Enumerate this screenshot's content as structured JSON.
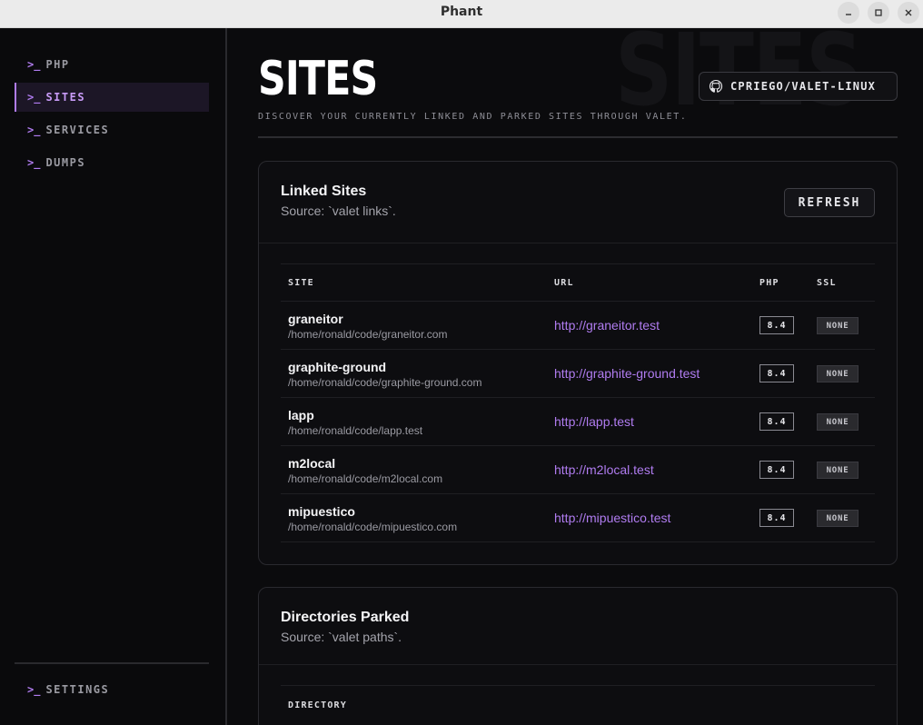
{
  "window": {
    "title": "Phant"
  },
  "sidebar": {
    "prompt": ">_",
    "items": [
      {
        "label": "PHP",
        "active": false
      },
      {
        "label": "SITES",
        "active": true
      },
      {
        "label": "SERVICES",
        "active": false
      },
      {
        "label": "DUMPS",
        "active": false
      }
    ],
    "settings": {
      "label": "SETTINGS"
    }
  },
  "header": {
    "watermark": "SITES",
    "title": "SITES",
    "subtitle": "DISCOVER YOUR CURRENTLY LINKED AND PARKED SITES THROUGH VALET.",
    "repo_label": "CPRIEGO/VALET-LINUX",
    "repo_icon": "github-icon"
  },
  "linked": {
    "title": "Linked Sites",
    "source": "Source: `valet links`.",
    "refresh_label": "REFRESH",
    "columns": [
      "SITE",
      "URL",
      "PHP",
      "SSL"
    ],
    "rows": [
      {
        "name": "graneitor",
        "path": "/home/ronald/code/graneitor.com",
        "url": "http://graneitor.test",
        "php": "8.4",
        "ssl": "NONE"
      },
      {
        "name": "graphite-ground",
        "path": "/home/ronald/code/graphite-ground.com",
        "url": "http://graphite-ground.test",
        "php": "8.4",
        "ssl": "NONE"
      },
      {
        "name": "lapp",
        "path": "/home/ronald/code/lapp.test",
        "url": "http://lapp.test",
        "php": "8.4",
        "ssl": "NONE"
      },
      {
        "name": "m2local",
        "path": "/home/ronald/code/m2local.com",
        "url": "http://m2local.test",
        "php": "8.4",
        "ssl": "NONE"
      },
      {
        "name": "mipuestico",
        "path": "/home/ronald/code/mipuestico.com",
        "url": "http://mipuestico.test",
        "php": "8.4",
        "ssl": "NONE"
      }
    ]
  },
  "parked": {
    "title": "Directories Parked",
    "source": "Source: `valet paths`.",
    "columns": [
      "DIRECTORY"
    ]
  },
  "colors": {
    "accent": "#b07cf0",
    "background": "#0b0b0d",
    "card": "#0d0d10"
  }
}
